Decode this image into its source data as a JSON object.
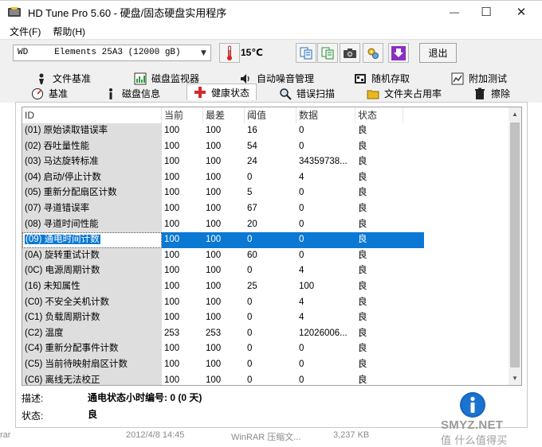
{
  "window": {
    "title": "HD Tune Pro 5.60 - 硬盘/固态硬盘实用程序",
    "minimize": "—",
    "maximize": "☐",
    "close": "✕"
  },
  "menu": [
    {
      "label": "文件(F)"
    },
    {
      "label": "帮助(H)"
    }
  ],
  "toolbar": {
    "drive": "WD     Elements 25A3 (12000 gB)",
    "temperature": "15℃",
    "exit_label": "退出"
  },
  "tabs_row1": [
    {
      "label": "文件基准",
      "icon": "file-benchmark-icon"
    },
    {
      "label": "磁盘监视器",
      "icon": "disk-monitor-icon"
    },
    {
      "label": "自动噪音管理",
      "icon": "noise-management-icon"
    },
    {
      "label": "随机存取",
      "icon": "random-access-icon"
    },
    {
      "label": "附加测试",
      "icon": "extra-tests-icon"
    }
  ],
  "tabs_row2": [
    {
      "label": "基准",
      "icon": "benchmark-icon"
    },
    {
      "label": "磁盘信息",
      "icon": "disk-info-icon"
    },
    {
      "label": "健康状态",
      "icon": "health-icon",
      "active": true
    },
    {
      "label": "错误扫描",
      "icon": "error-scan-icon"
    },
    {
      "label": "文件夹占用率",
      "icon": "folder-usage-icon"
    },
    {
      "label": "擦除",
      "icon": "erase-icon"
    }
  ],
  "table": {
    "columns": [
      "ID",
      "当前",
      "最差",
      "阈值",
      "数据",
      "状态"
    ],
    "rows": [
      [
        "(01) 原始读取错误率",
        "100",
        "100",
        "16",
        "0",
        "良"
      ],
      [
        "(02) 吞吐量性能",
        "100",
        "100",
        "54",
        "0",
        "良"
      ],
      [
        "(03) 马达旋转标准",
        "100",
        "100",
        "24",
        "34359738...",
        "良"
      ],
      [
        "(04) 启动/停止计数",
        "100",
        "100",
        "0",
        "4",
        "良"
      ],
      [
        "(05) 重新分配扇区计数",
        "100",
        "100",
        "5",
        "0",
        "良"
      ],
      [
        "(07) 寻道错误率",
        "100",
        "100",
        "67",
        "0",
        "良"
      ],
      [
        "(08) 寻道时间性能",
        "100",
        "100",
        "20",
        "0",
        "良"
      ],
      [
        "(09) 通电时间计数",
        "100",
        "100",
        "0",
        "0",
        "良"
      ],
      [
        "(0A) 旋转重试计数",
        "100",
        "100",
        "60",
        "0",
        "良"
      ],
      [
        "(0C) 电源周期计数",
        "100",
        "100",
        "0",
        "4",
        "良"
      ],
      [
        "(16) 未知属性",
        "100",
        "100",
        "25",
        "100",
        "良"
      ],
      [
        "(C0) 不安全关机计数",
        "100",
        "100",
        "0",
        "4",
        "良"
      ],
      [
        "(C1) 负载周期计数",
        "100",
        "100",
        "0",
        "4",
        "良"
      ],
      [
        "(C2) 温度",
        "253",
        "253",
        "0",
        "12026006...",
        "良"
      ],
      [
        "(C4) 重新分配事件计数",
        "100",
        "100",
        "0",
        "0",
        "良"
      ],
      [
        "(C5) 当前待映射扇区计数",
        "100",
        "100",
        "0",
        "0",
        "良"
      ],
      [
        "(C6) 离线无法校正",
        "100",
        "100",
        "0",
        "0",
        "良"
      ]
    ],
    "selected_row": 7
  },
  "details": {
    "description_label": "描述:",
    "description_value": "通电状态小时编号: 0 (0 天)",
    "status_label": "状态:",
    "status_value": "良"
  },
  "background": {
    "left_text": "rar",
    "date": "2012/4/8 14:45",
    "app": "WinRAR 压缩文...",
    "size": "3,237 KB"
  },
  "watermark": {
    "text": "SMYZ.NET",
    "sub": "值 什么值得买"
  },
  "colors": {
    "selection": "#0b78d4",
    "id_column_bg": "#dedede",
    "info_button": "#1565c0"
  }
}
